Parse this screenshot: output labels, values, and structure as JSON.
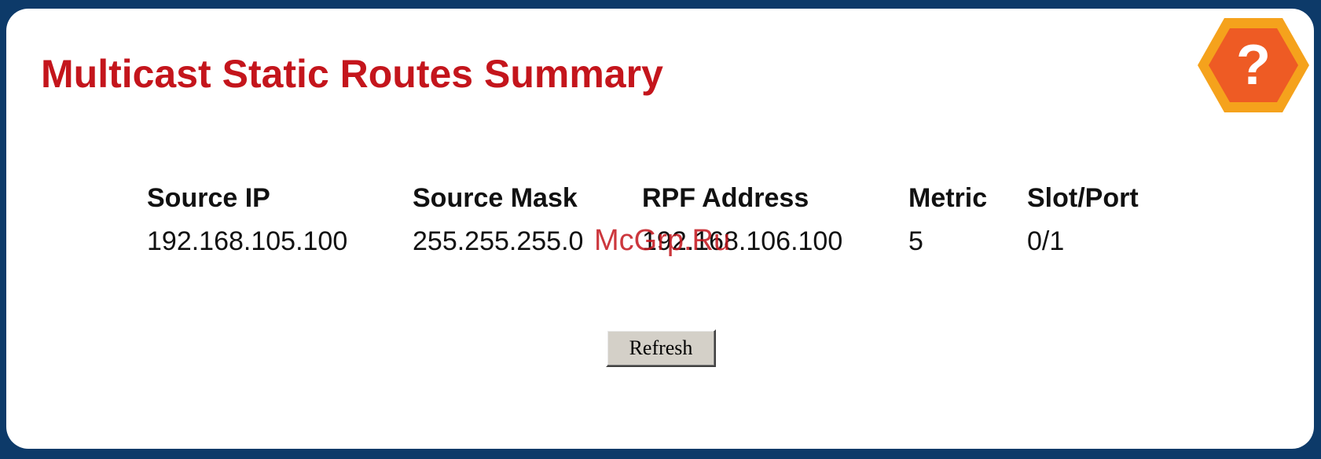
{
  "page": {
    "title": "Multicast Static Routes Summary"
  },
  "help": {
    "icon": "help-question-icon",
    "glyph": "?",
    "colors": {
      "outer": "#f5a21c",
      "inner": "#ee5b24",
      "glyph": "#ffffff"
    }
  },
  "table": {
    "columns": [
      "Source IP",
      "Source Mask",
      "RPF Address",
      "Metric",
      "Slot/Port"
    ],
    "rows": [
      [
        "192.168.105.100",
        "255.255.255.0",
        "192.168.106.100",
        "5",
        "0/1"
      ]
    ]
  },
  "actions": {
    "refresh_label": "Refresh"
  },
  "watermark": "McGrp.Ru",
  "colors": {
    "frame": "#0d3a69",
    "panel": "#ffffff",
    "title": "#c4151c",
    "button": "#d4d0c8"
  }
}
